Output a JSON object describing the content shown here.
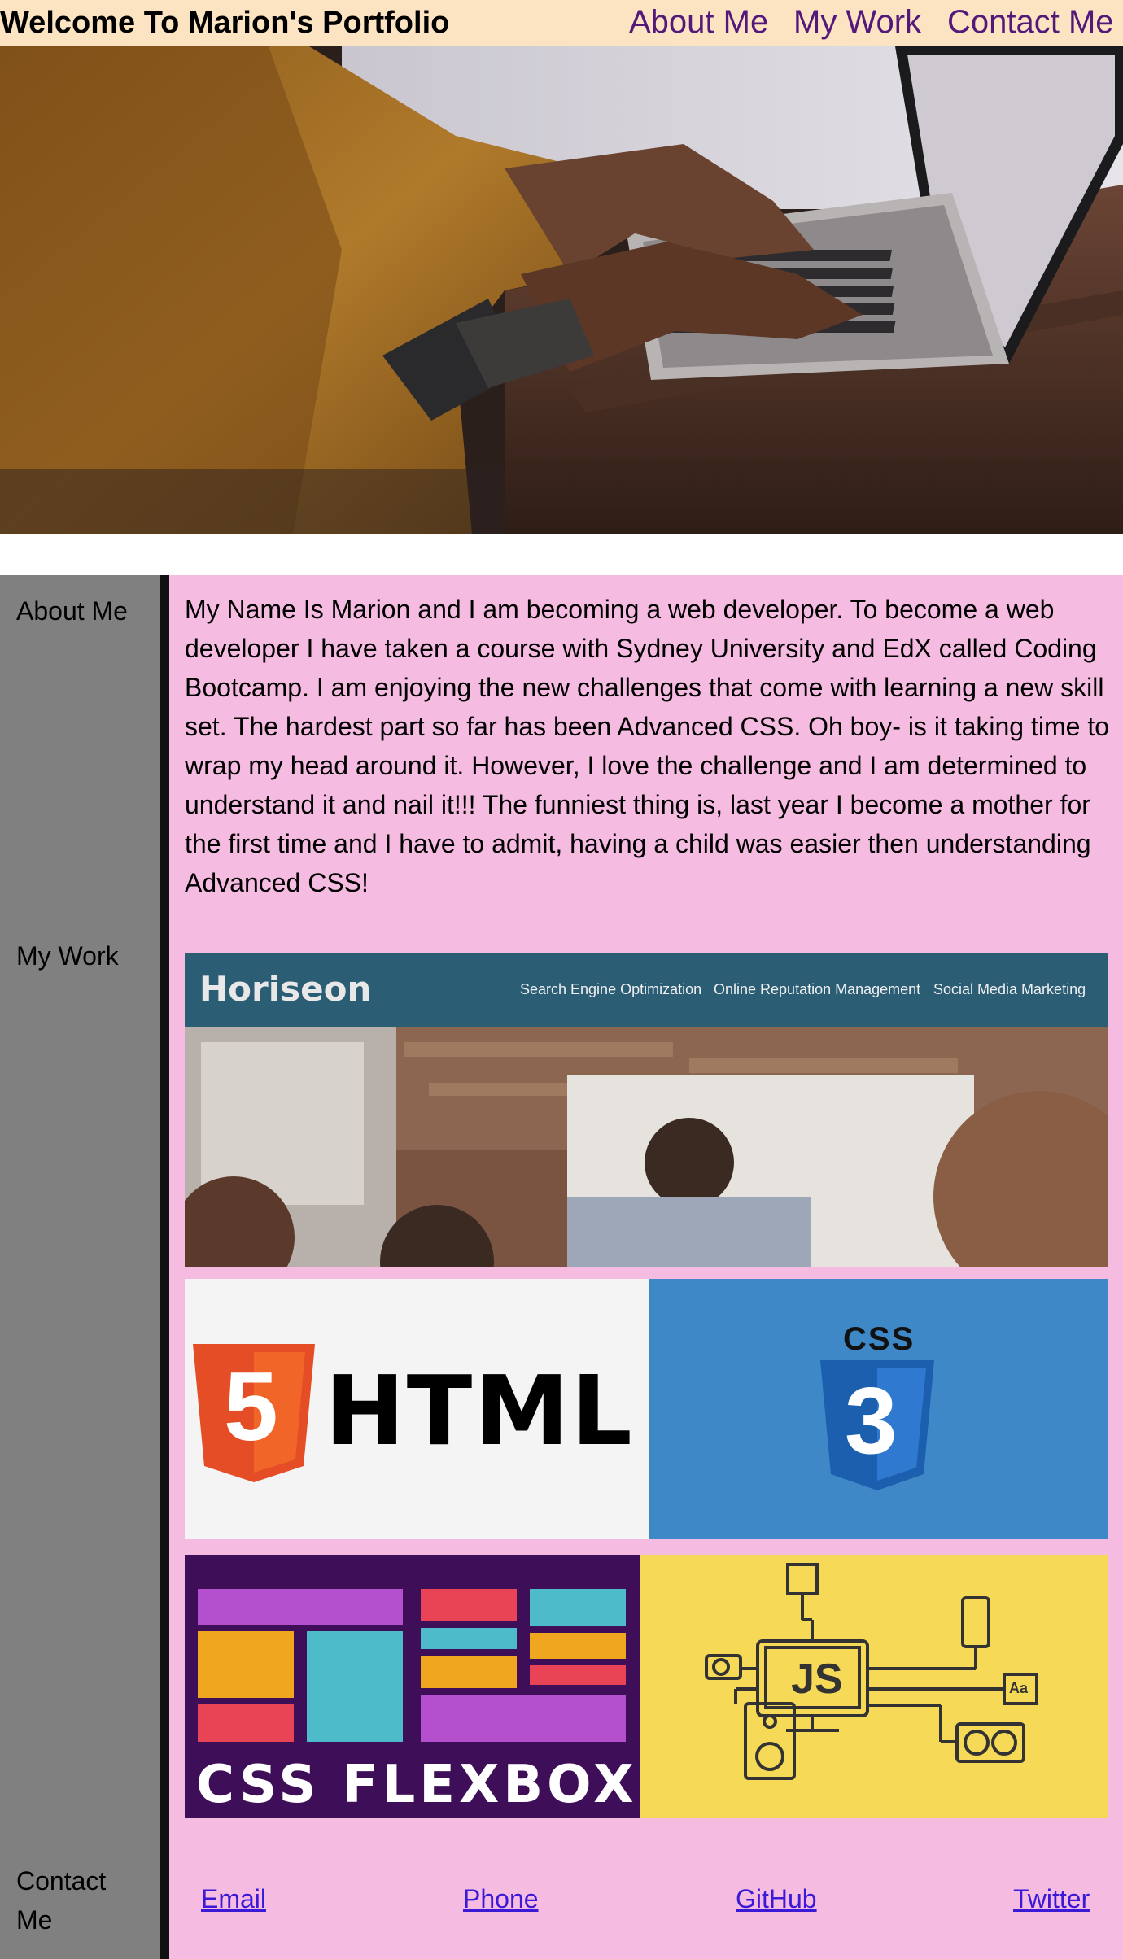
{
  "header": {
    "title": "Welcome To Marion's Portfolio",
    "nav": [
      "About Me",
      "My Work",
      "Contact Me"
    ]
  },
  "sidebar": {
    "about": "About Me",
    "work": "My Work",
    "contact": "Contact Me"
  },
  "about": {
    "text": "My Name Is Marion and I am becoming a web developer. To become a web developer I have taken a course with Sydney University and EdX called Coding Bootcamp. I am enjoying the new challenges that come with learning a new skill set. The hardest part so far has been Advanced CSS. Oh boy- is it taking time to wrap my head around it. However, I love the challenge and I am determined to understand it and nail it!!! The funniest thing is, last year I become a mother for the first time and I have to admit, having a child was easier then understanding Advanced CSS!"
  },
  "work": {
    "horiseon": {
      "logo": "Horiseon",
      "nav": [
        "Search Engine Optimization",
        "Online Reputation Management",
        "Social Media Marketing"
      ]
    },
    "html_tile": {
      "badge": "5",
      "label": "HTML"
    },
    "css_tile": {
      "top_label": "CSS",
      "badge": "3"
    },
    "flexbox_tile": {
      "label": "CSS FLEXBOX"
    },
    "js_tile": {
      "label": "JS",
      "aa": "Aa"
    }
  },
  "footer": {
    "links": [
      "Email",
      "Phone",
      "GitHub",
      "Twitter"
    ]
  },
  "colors": {
    "header_bg": "#fce4c3",
    "nav_link": "#53197a",
    "sidebar_bg": "#808080",
    "content_bg": "#f5bbe1",
    "footer_link": "#3a1ad6"
  }
}
